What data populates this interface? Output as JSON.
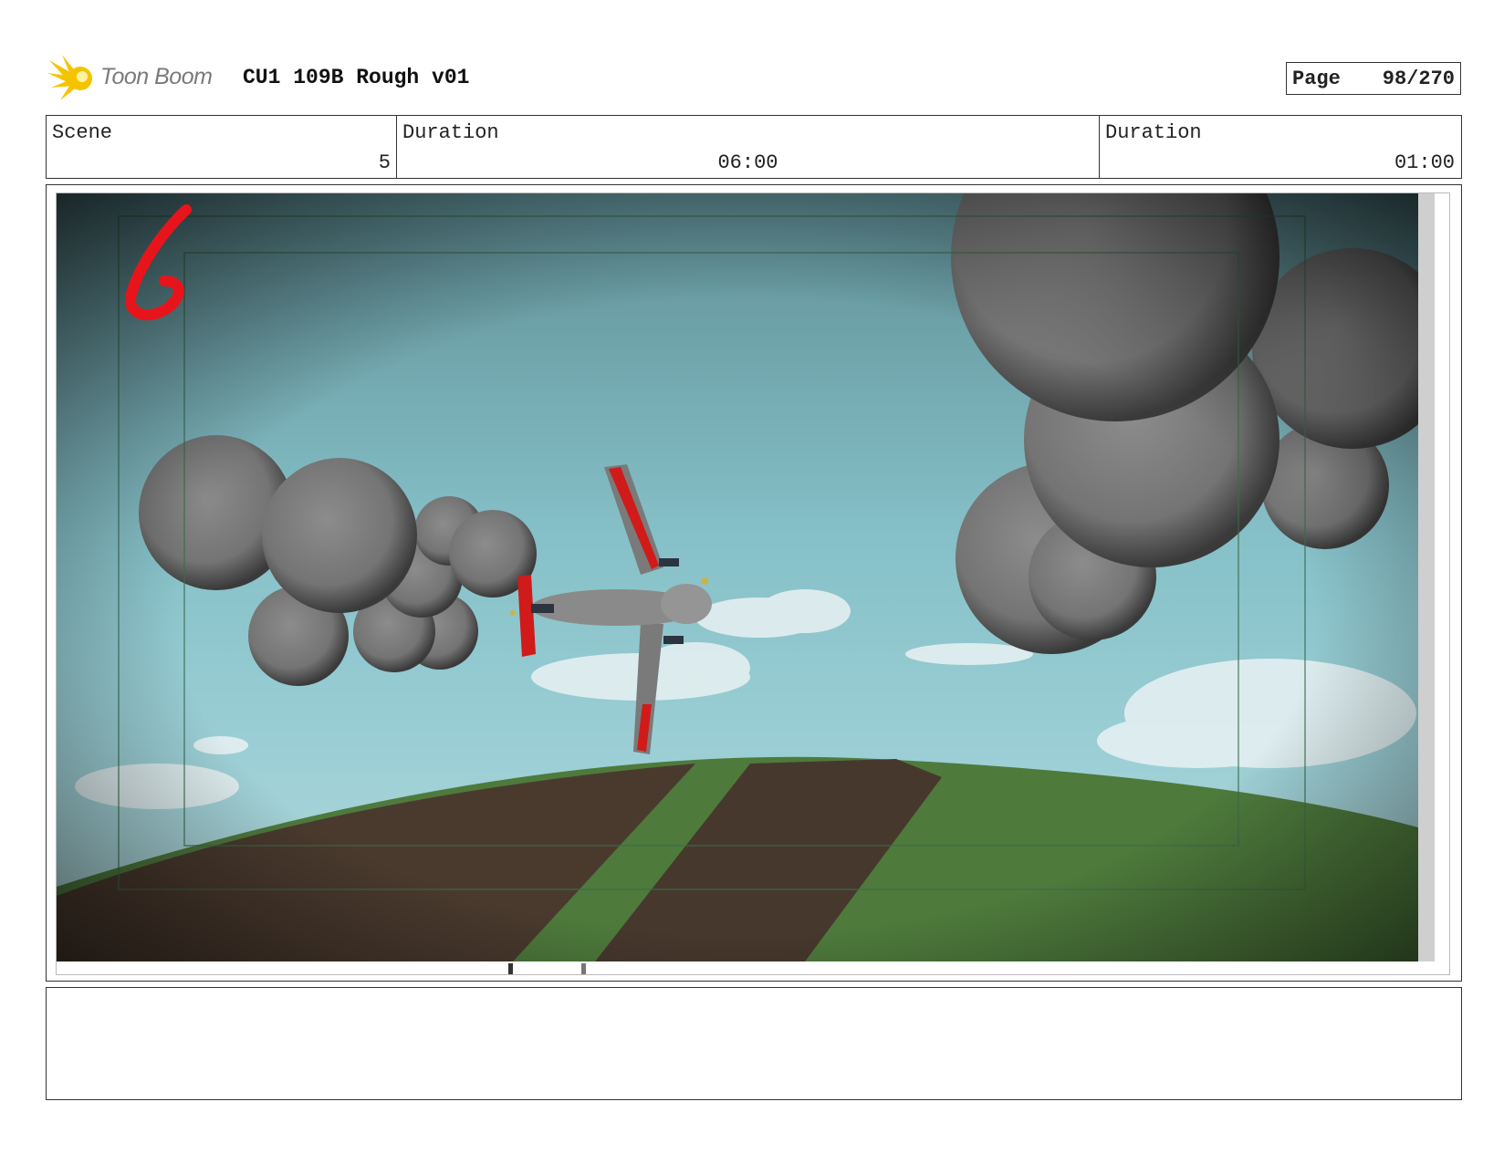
{
  "header": {
    "logo_text": "Toon Boom",
    "project_title": "CU1 109B Rough v01",
    "page_label": "Page",
    "page_number": "98/270"
  },
  "info": {
    "scene_label": "Scene",
    "scene_value": "5",
    "duration_label_1": "Duration",
    "duration_value_1": "06:00",
    "duration_label_2": "Duration",
    "duration_value_2": "01:00"
  },
  "panel": {
    "panel_number_mark": "6"
  },
  "notes": {
    "text": ""
  },
  "colors": {
    "logo_yellow": "#f5c400",
    "panel_mark_red": "#e8141c",
    "plane_red": "#d11a1a",
    "sky": "#7fbcc6",
    "ground_green": "#4e7a3c",
    "ground_brown": "#4a3a2e",
    "cloud_gray": "#7d7d7d"
  }
}
